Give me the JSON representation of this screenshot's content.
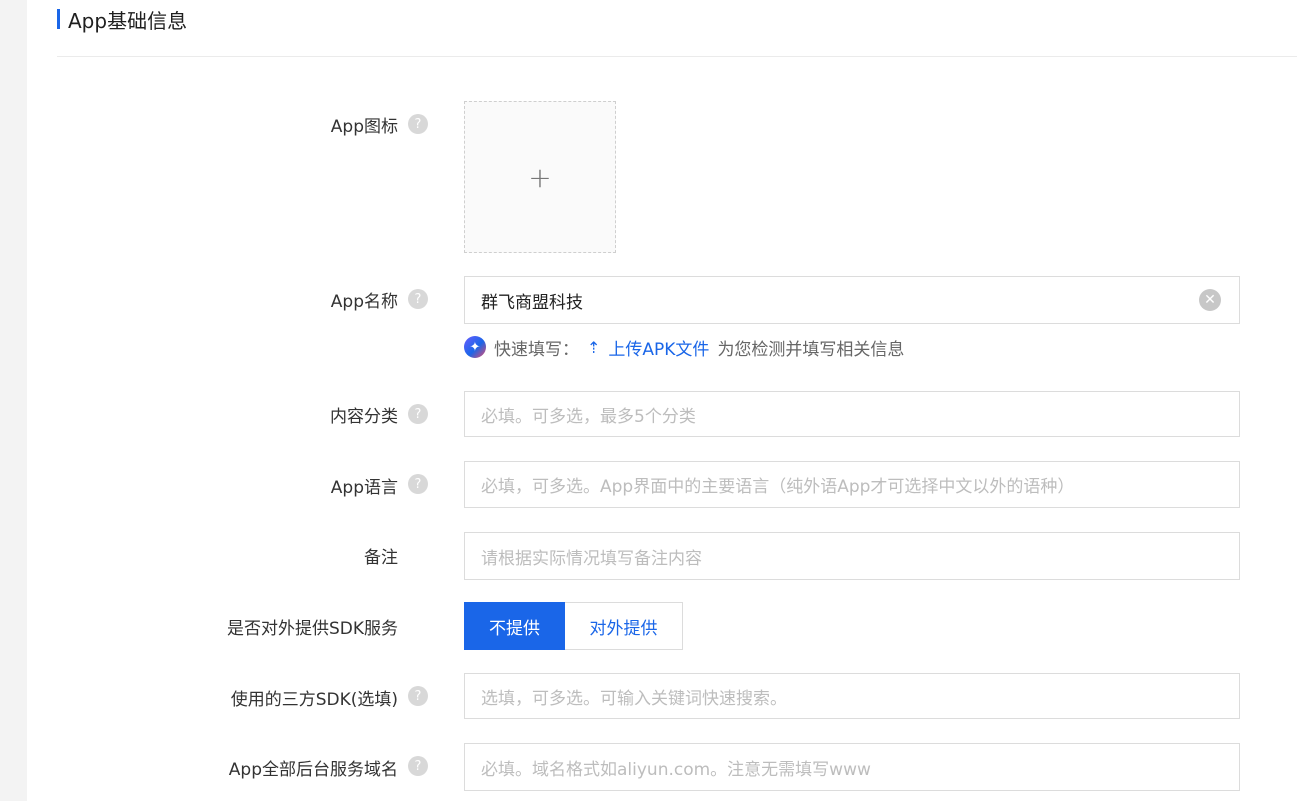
{
  "section": {
    "title": "App基础信息"
  },
  "fields": {
    "icon": {
      "label": "App图标",
      "upload_symbol": "+"
    },
    "name": {
      "label": "App名称",
      "value": "群飞商盟科技"
    },
    "quickfill": {
      "prefix": "快速填写：",
      "link": "上传APK文件",
      "suffix": "为您检测并填写相关信息"
    },
    "category": {
      "label": "内容分类",
      "placeholder": "必填。可多选，最多5个分类"
    },
    "language": {
      "label": "App语言",
      "placeholder": "必填，可多选。App界面中的主要语言（纯外语App才可选择中文以外的语种）"
    },
    "remark": {
      "label": "备注",
      "placeholder": "请根据实际情况填写备注内容"
    },
    "sdk_service": {
      "label": "是否对外提供SDK服务",
      "options": [
        "不提供",
        "对外提供"
      ],
      "selected": "不提供"
    },
    "third_sdk": {
      "label": "使用的三方SDK(选填)",
      "placeholder": "选填，可多选。可输入关键词快速搜索。"
    },
    "domains": {
      "label": "App全部后台服务域名",
      "placeholder": "必填。域名格式如aliyun.com。注意无需填写www"
    }
  },
  "help_symbol": "?",
  "colors": {
    "accent": "#1a66e8"
  }
}
